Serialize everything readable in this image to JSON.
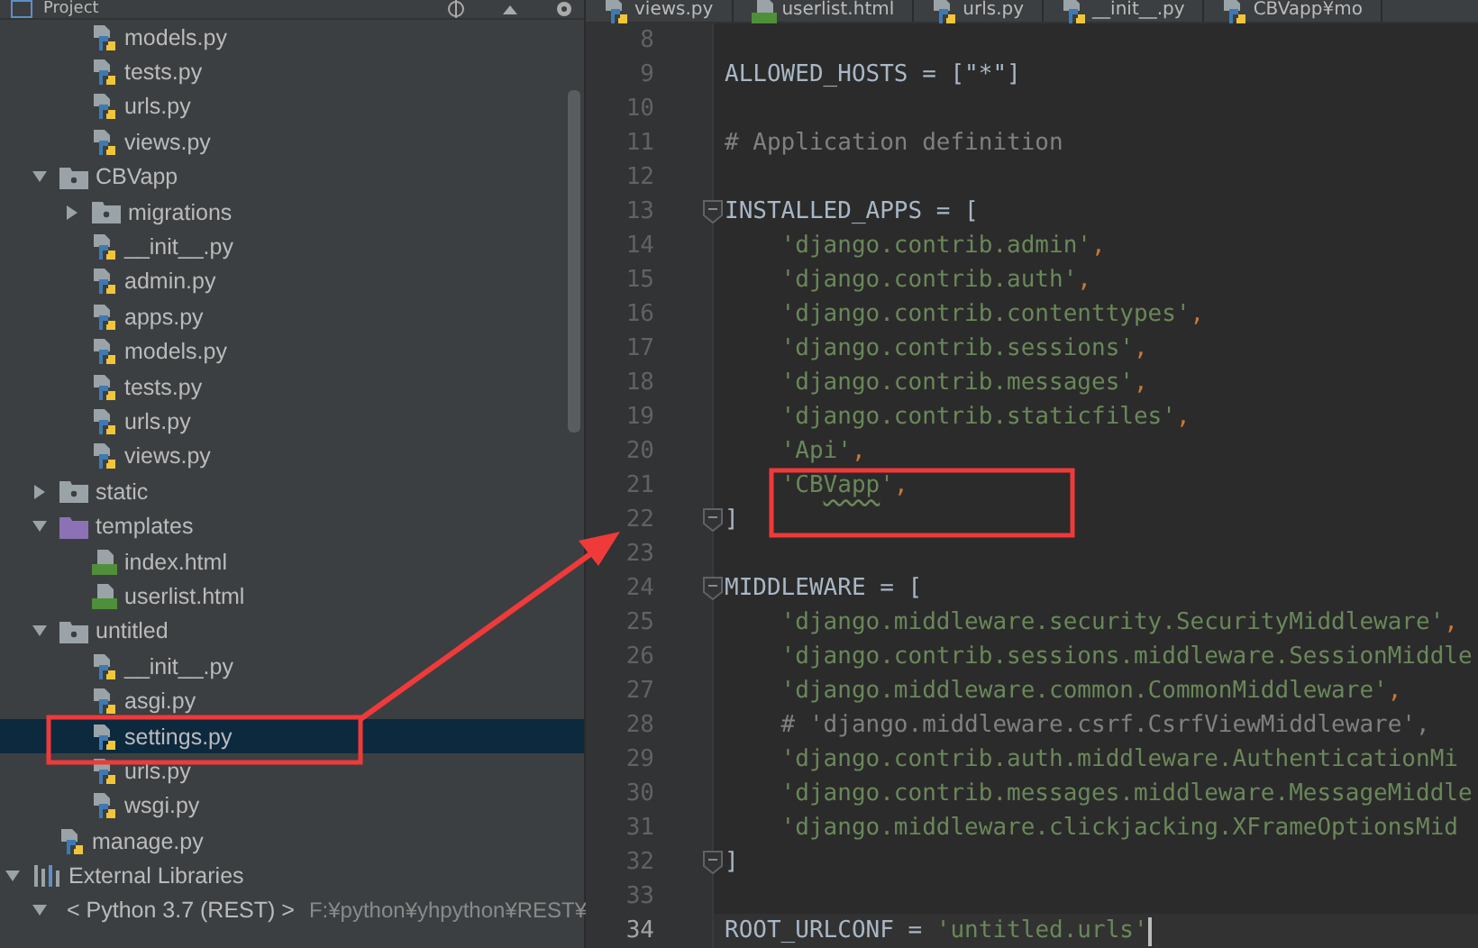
{
  "project_panel": {
    "title": "Project"
  },
  "partial_folder_files": [
    {
      "label": "models.py",
      "kind": "python",
      "selected": false
    },
    {
      "label": "tests.py",
      "kind": "python",
      "selected": false
    },
    {
      "label": "urls.py",
      "kind": "python",
      "selected": false
    },
    {
      "label": "views.py",
      "kind": "python",
      "selected": false
    }
  ],
  "tree": [
    {
      "label": "CBVapp",
      "kind": "package",
      "expanded": true,
      "selected": false,
      "children": [
        {
          "label": "migrations",
          "kind": "package",
          "expanded": false,
          "selected": false
        },
        {
          "label": "__init__.py",
          "kind": "python",
          "selected": false
        },
        {
          "label": "admin.py",
          "kind": "python",
          "selected": false
        },
        {
          "label": "apps.py",
          "kind": "python",
          "selected": false
        },
        {
          "label": "models.py",
          "kind": "python",
          "selected": false
        },
        {
          "label": "tests.py",
          "kind": "python",
          "selected": false
        },
        {
          "label": "urls.py",
          "kind": "python",
          "selected": false
        },
        {
          "label": "views.py",
          "kind": "python",
          "selected": false
        }
      ]
    },
    {
      "label": "static",
      "kind": "package",
      "expanded": false,
      "selected": false
    },
    {
      "label": "templates",
      "kind": "templates",
      "expanded": true,
      "selected": false,
      "children": [
        {
          "label": "index.html",
          "kind": "html",
          "selected": false
        },
        {
          "label": "userlist.html",
          "kind": "html",
          "selected": false
        }
      ]
    },
    {
      "label": "untitled",
      "kind": "package",
      "expanded": true,
      "selected": false,
      "children": [
        {
          "label": "__init__.py",
          "kind": "python",
          "selected": false
        },
        {
          "label": "asgi.py",
          "kind": "python",
          "selected": false
        },
        {
          "label": "settings.py",
          "kind": "python",
          "selected": true
        },
        {
          "label": "urls.py",
          "kind": "python",
          "selected": false
        },
        {
          "label": "wsgi.py",
          "kind": "python",
          "selected": false
        }
      ]
    },
    {
      "label": "manage.py",
      "kind": "python",
      "selected": false
    }
  ],
  "external_libraries": {
    "label": "External Libraries",
    "kind": "library",
    "expanded": true,
    "selected": false,
    "children": [
      {
        "label": "< Python 3.7 (REST) >",
        "path": "F:¥python¥yhpython¥REST¥",
        "kind": "sdk",
        "expanded": true,
        "selected": false
      }
    ]
  },
  "editor_tabs": [
    {
      "label": "views.py",
      "kind": "python"
    },
    {
      "label": "userlist.html",
      "kind": "html"
    },
    {
      "label": "urls.py",
      "kind": "python"
    },
    {
      "label": "__init__.py",
      "kind": "python"
    },
    {
      "label": "CBVapp¥mo",
      "kind": "python"
    }
  ],
  "code_lines": [
    {
      "number": "8",
      "current": false
    },
    {
      "number": "9",
      "current": false,
      "tokens": [
        {
          "kind": "plain",
          "text": "ALLOWED_HOSTS = [\"*\"]"
        }
      ]
    },
    {
      "number": "10",
      "current": false
    },
    {
      "number": "11",
      "current": false,
      "tokens": [
        {
          "kind": "comment",
          "text": "# Application definition"
        }
      ]
    },
    {
      "number": "12",
      "current": false
    },
    {
      "number": "13",
      "current": false,
      "fold": true,
      "tokens": [
        {
          "kind": "plain",
          "text": "INSTALLED_APPS = ["
        }
      ]
    },
    {
      "number": "14",
      "current": false,
      "tokens": [
        {
          "kind": "string",
          "text": "    'django.contrib.admin'"
        },
        {
          "kind": "punct",
          "text": ","
        }
      ]
    },
    {
      "number": "15",
      "current": false,
      "tokens": [
        {
          "kind": "string",
          "text": "    'django.contrib.auth'"
        },
        {
          "kind": "punct",
          "text": ","
        }
      ]
    },
    {
      "number": "16",
      "current": false,
      "tokens": [
        {
          "kind": "string",
          "text": "    'django.contrib.contenttypes'"
        },
        {
          "kind": "punct",
          "text": ","
        }
      ]
    },
    {
      "number": "17",
      "current": false,
      "tokens": [
        {
          "kind": "string",
          "text": "    'django.contrib.sessions'"
        },
        {
          "kind": "punct",
          "text": ","
        }
      ]
    },
    {
      "number": "18",
      "current": false,
      "tokens": [
        {
          "kind": "string",
          "text": "    'django.contrib.messages'"
        },
        {
          "kind": "punct",
          "text": ","
        }
      ]
    },
    {
      "number": "19",
      "current": false,
      "tokens": [
        {
          "kind": "string",
          "text": "    'django.contrib.staticfiles'"
        },
        {
          "kind": "punct",
          "text": ","
        }
      ]
    },
    {
      "number": "20",
      "current": false,
      "tokens": [
        {
          "kind": "string",
          "text": "    'Api'"
        },
        {
          "kind": "punct",
          "text": ","
        }
      ]
    },
    {
      "number": "21",
      "current": false,
      "tokens": [
        {
          "kind": "string",
          "text": "    'CB"
        },
        {
          "kind": "typo",
          "text": "Vapp"
        },
        {
          "kind": "string",
          "text": "'"
        },
        {
          "kind": "punct",
          "text": ","
        }
      ]
    },
    {
      "number": "22",
      "current": false,
      "fold": true,
      "tokens": [
        {
          "kind": "plain",
          "text": "]"
        }
      ]
    },
    {
      "number": "23",
      "current": false
    },
    {
      "number": "24",
      "current": false,
      "fold": true,
      "tokens": [
        {
          "kind": "plain",
          "text": "MIDDLEWARE = ["
        }
      ]
    },
    {
      "number": "25",
      "current": false,
      "tokens": [
        {
          "kind": "string",
          "text": "    'django.middleware.security.SecurityMiddleware'"
        },
        {
          "kind": "punct",
          "text": ","
        }
      ]
    },
    {
      "number": "26",
      "current": false,
      "tokens": [
        {
          "kind": "string",
          "text": "    'django.contrib.sessions.middleware.SessionMiddle"
        }
      ]
    },
    {
      "number": "27",
      "current": false,
      "tokens": [
        {
          "kind": "string",
          "text": "    'django.middleware.common.CommonMiddleware'"
        },
        {
          "kind": "punct",
          "text": ","
        }
      ]
    },
    {
      "number": "28",
      "current": false,
      "tokens": [
        {
          "kind": "comment",
          "text": "    # 'django.middleware.csrf.CsrfViewMiddleware',"
        }
      ]
    },
    {
      "number": "29",
      "current": false,
      "tokens": [
        {
          "kind": "string",
          "text": "    'django.contrib.auth.middleware.AuthenticationMi"
        }
      ]
    },
    {
      "number": "30",
      "current": false,
      "tokens": [
        {
          "kind": "string",
          "text": "    'django.contrib.messages.middleware.MessageMiddle"
        }
      ]
    },
    {
      "number": "31",
      "current": false,
      "tokens": [
        {
          "kind": "string",
          "text": "    'django.middleware.clickjacking.XFrameOptionsMid"
        }
      ]
    },
    {
      "number": "32",
      "current": false,
      "fold": true,
      "tokens": [
        {
          "kind": "plain",
          "text": "]"
        }
      ]
    },
    {
      "number": "33",
      "current": false
    },
    {
      "number": "34",
      "current": true,
      "tokens": [
        {
          "kind": "plain",
          "text": "ROOT_URLCONF = "
        },
        {
          "kind": "string",
          "text": "'untitled.urls'"
        }
      ]
    }
  ]
}
